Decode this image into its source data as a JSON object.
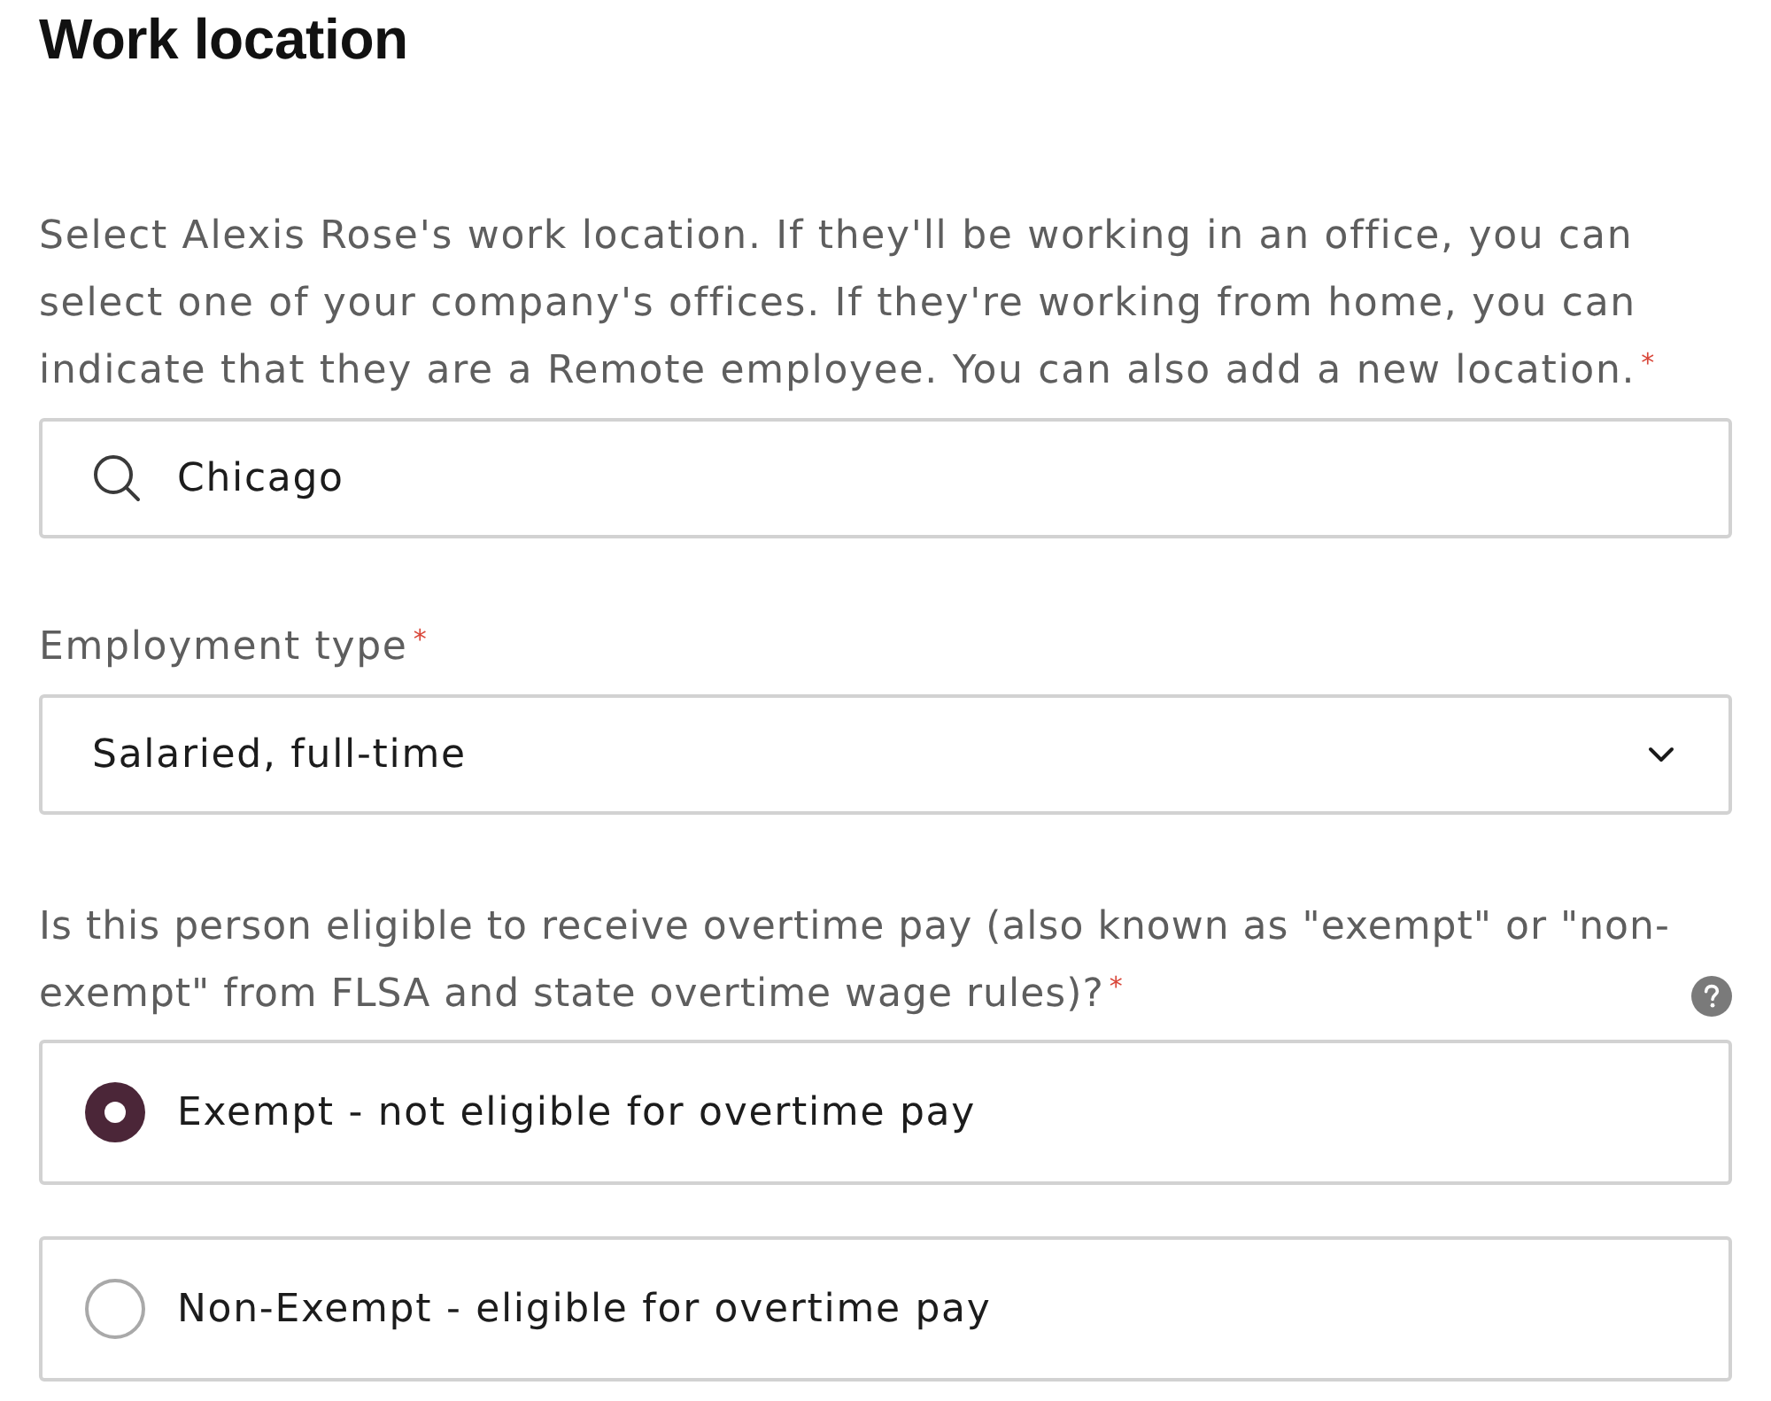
{
  "section": {
    "title": "Work location"
  },
  "location": {
    "description": "Select Alexis Rose's work location. If they'll be working in an office, you can select one of your company's offices. If they're working from home, you can indicate that they are a Remote employee. You can also add a new location.$^{*}$",
    "search": {
      "value": "Chicago"
    }
  },
  "employment_type": {
    "label": "Employment type$^{*}$",
    "value": "Salaried, full-time"
  },
  "overtime": {
    "question": "Is this person eligible to receive overtime pay (also known as \"exempt\" or \"non-exempt\" from FLSA and state overtime wage rules)?$^{*}$",
    "help": true,
    "options": [
      {
        "label": "Exempt - not eligible for overtime pay",
        "selected": true
      },
      {
        "label": "Non-Exempt - eligible for overtime pay",
        "selected": false
      }
    ]
  }
}
